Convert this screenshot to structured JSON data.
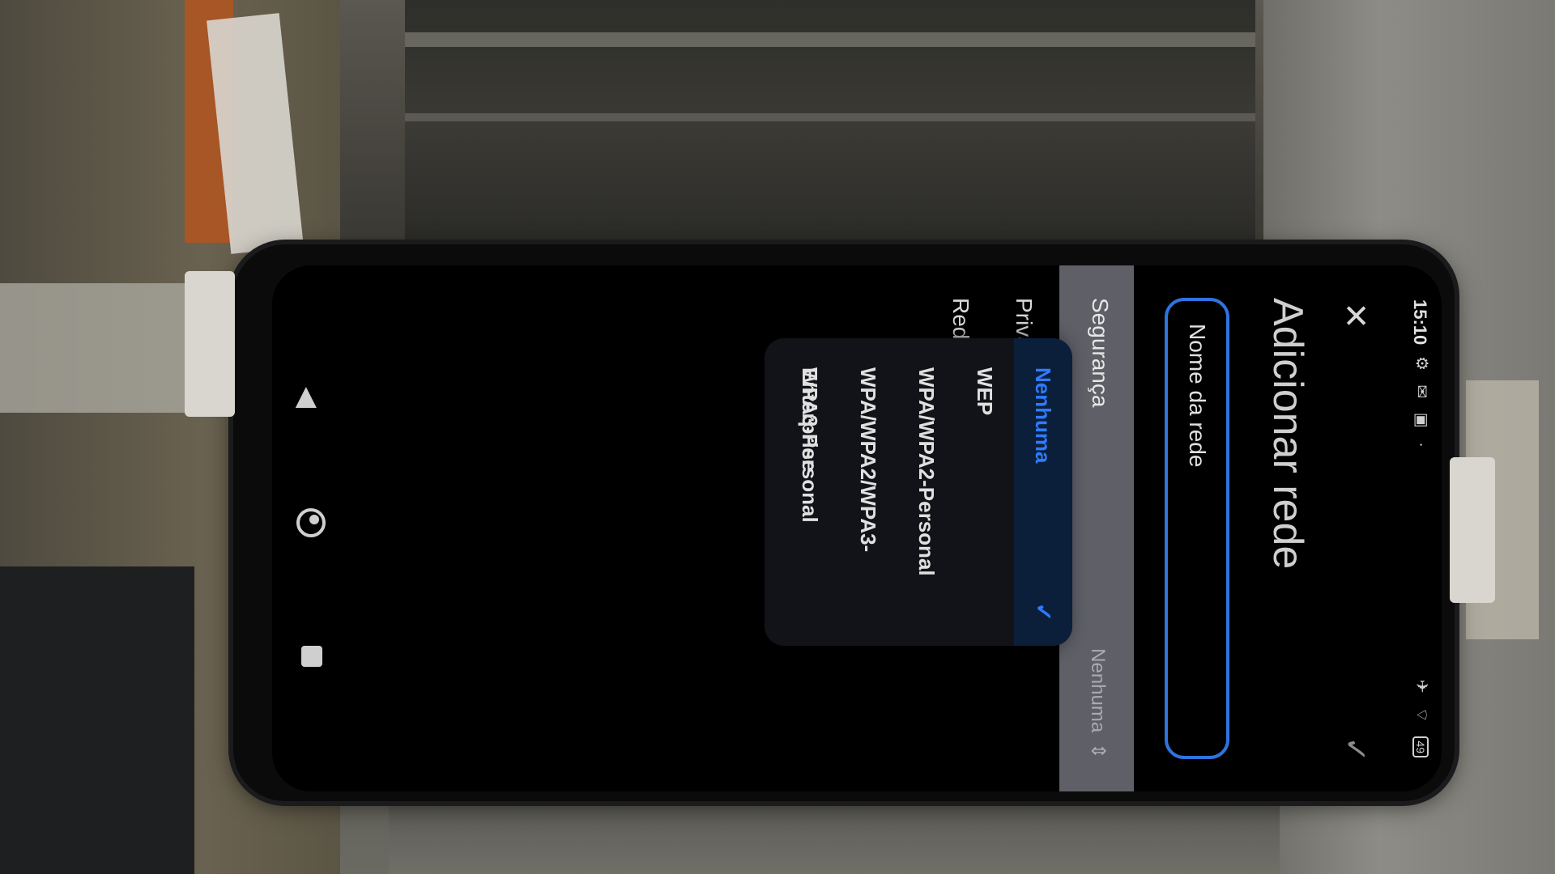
{
  "status_bar": {
    "time": "15:10",
    "left_icons": "⚙ ✉ ▣ ·",
    "right_icons": "✈ ⌔",
    "battery": "49"
  },
  "header": {
    "close_icon": "close-icon",
    "confirm_icon": "chevron-check-icon",
    "title": "Adicionar rede"
  },
  "form": {
    "network_name_placeholder": "Nome da rede",
    "security_label": "Segurança",
    "security_value": "Nenhuma",
    "privacy_label": "Priva",
    "network_label": "Rede"
  },
  "security_dropdown": {
    "options": [
      {
        "label": "Nenhuma",
        "selected": true
      },
      {
        "label": "WEP",
        "selected": false
      },
      {
        "label": "WPA/WPA2-Personal",
        "selected": false
      },
      {
        "label": "WPA/WPA2/WPA3-Enterprise",
        "selected": false
      },
      {
        "label": "WPA3-Personal",
        "selected": false
      }
    ]
  },
  "nav_bar": {
    "back_icon": "back-triangle-icon",
    "home_icon": "home-circle-icon",
    "recents_icon": "recents-square-icon"
  },
  "colors": {
    "accent": "#2f7bff",
    "field_border": "#2f73e0",
    "security_row_bg": "#5e5f67",
    "popup_bg": "#121318",
    "selected_bg": "#0c1f3a"
  }
}
